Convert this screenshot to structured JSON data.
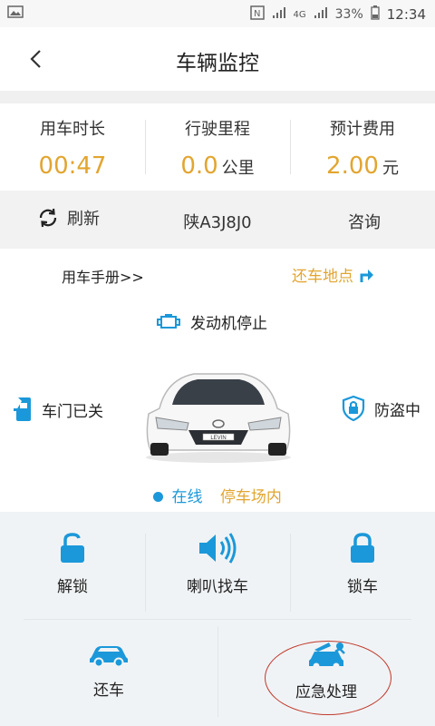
{
  "status_bar": {
    "battery": "33%",
    "time": "12:34",
    "network": "4G"
  },
  "header": {
    "title": "车辆监控"
  },
  "stats": [
    {
      "label": "用车时长",
      "value": "00:47",
      "unit": ""
    },
    {
      "label": "行驶里程",
      "value": "0.0",
      "unit": "公里"
    },
    {
      "label": "预计费用",
      "value": "2.00",
      "unit": "元"
    }
  ],
  "plate_bar": {
    "refresh_label": "刷新",
    "plate": "陕A3J8J0",
    "consult_label": "咨询"
  },
  "main": {
    "manual_link": "用车手册>>",
    "return_location": "还车地点",
    "engine_status": "发动机停止",
    "door_status": "车门已关",
    "antitheft_status": "防盗中",
    "online_status": "在线",
    "parking_status": "停车场内",
    "car_badge": "LEVIN"
  },
  "actions": {
    "unlock": "解锁",
    "horn": "喇叭找车",
    "lock": "锁车",
    "return_car": "还车",
    "emergency": "应急处理"
  },
  "colors": {
    "accent": "#1b98d9",
    "highlight": "#e2a530"
  }
}
